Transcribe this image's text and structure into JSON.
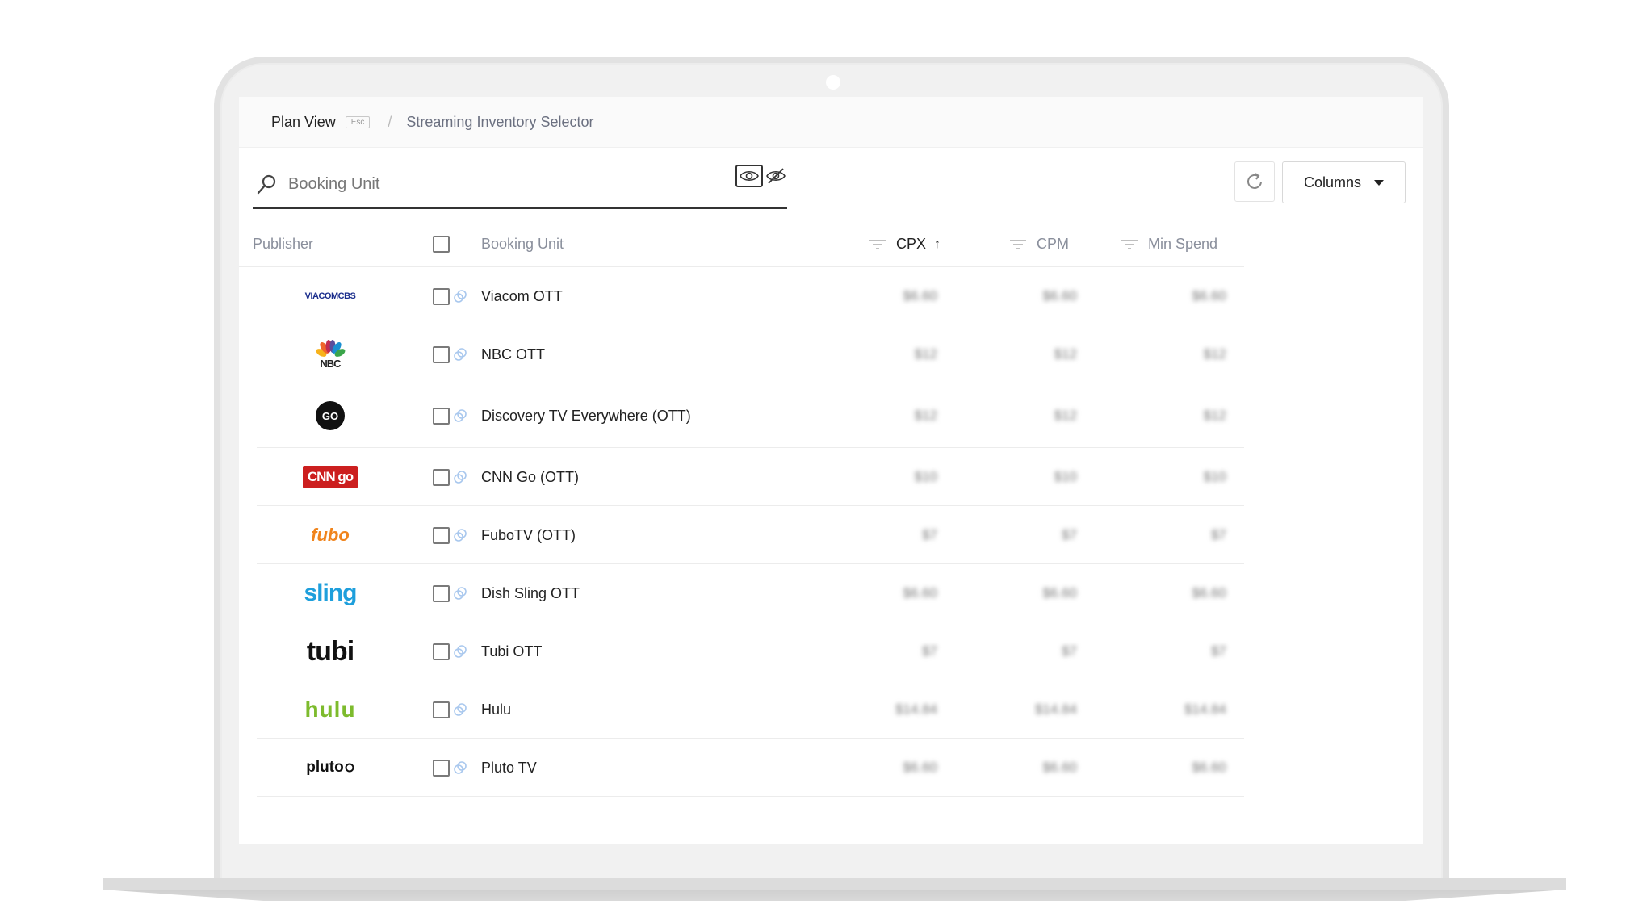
{
  "breadcrumb": {
    "plan_view": "Plan View",
    "esc": "Esc",
    "separator": "/",
    "current": "Streaming Inventory Selector"
  },
  "search": {
    "placeholder": "Booking Unit",
    "value": ""
  },
  "toolbar": {
    "columns_label": "Columns"
  },
  "table": {
    "headers": {
      "publisher": "Publisher",
      "booking_unit": "Booking Unit",
      "cpx": "CPX",
      "cpx_sort": "↑",
      "cpm": "CPM",
      "min_spend": "Min Spend"
    },
    "rows": [
      {
        "publisher": "VIACOMCBS",
        "unit": "Viacom OTT",
        "cpx": "$6.60",
        "cpm": "$6.60",
        "min_spend": "$6.60"
      },
      {
        "publisher": "NBC",
        "unit": "NBC OTT",
        "cpx": "$12",
        "cpm": "$12",
        "min_spend": "$12"
      },
      {
        "publisher": "GO",
        "unit": "Discovery TV Everywhere (OTT)",
        "cpx": "$12",
        "cpm": "$12",
        "min_spend": "$12"
      },
      {
        "publisher": "CNN go",
        "unit": "CNN Go (OTT)",
        "cpx": "$10",
        "cpm": "$10",
        "min_spend": "$10"
      },
      {
        "publisher": "fubo",
        "unit": "FuboTV (OTT)",
        "cpx": "$7",
        "cpm": "$7",
        "min_spend": "$7"
      },
      {
        "publisher": "sling",
        "unit": "Dish Sling OTT",
        "cpx": "$6.60",
        "cpm": "$6.60",
        "min_spend": "$6.60"
      },
      {
        "publisher": "tubi",
        "unit": "Tubi OTT",
        "cpx": "$7",
        "cpm": "$7",
        "min_spend": "$7"
      },
      {
        "publisher": "hulu",
        "unit": "Hulu",
        "cpx": "$14.84",
        "cpm": "$14.84",
        "min_spend": "$14.84"
      },
      {
        "publisher": "pluto",
        "unit": "Pluto TV",
        "cpx": "$6.60",
        "cpm": "$6.60",
        "min_spend": "$6.60"
      }
    ]
  },
  "colors": {
    "viacom": "#1a2d8c",
    "cnn": "#cc1f1f",
    "fubo": "#f0841c",
    "sling": "#1e9fdc",
    "hulu": "#7dbb2d"
  }
}
